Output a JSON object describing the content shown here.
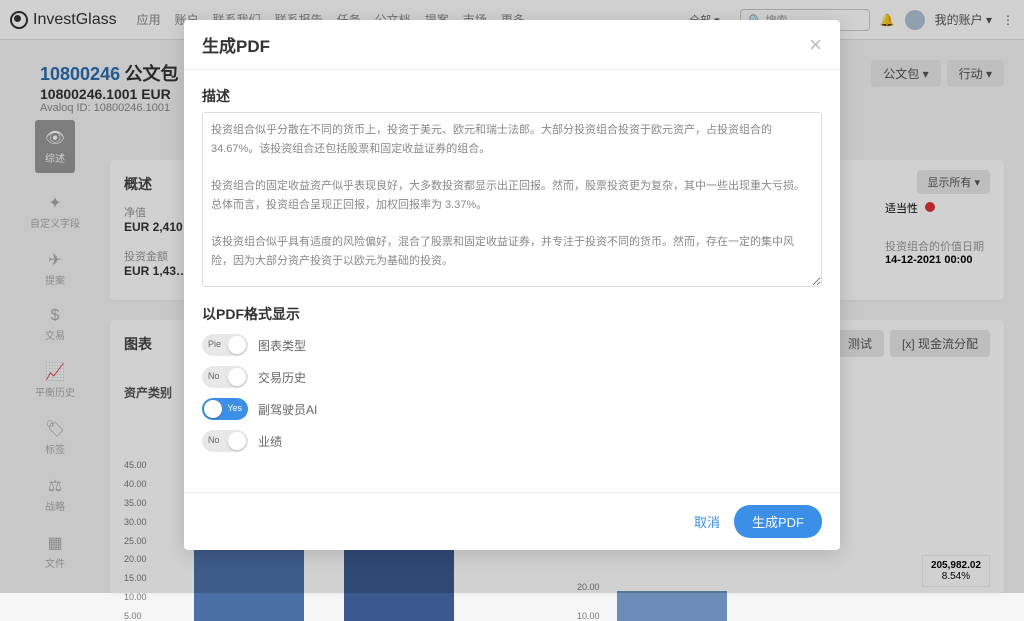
{
  "brand": "InvestGlass",
  "nav": {
    "items": [
      "应用",
      "账户",
      "联系我们",
      "联系报告",
      "任务",
      "公文档",
      "提案",
      "市场",
      "更多"
    ],
    "all": "全部",
    "search_placeholder": "搜索",
    "account": "我的账户"
  },
  "header": {
    "id1": "10800246",
    "id1_suffix": "公文包",
    "id2": "10800246.1001 EUR",
    "id3": "Avaloq ID: 10800246.1001",
    "btn_portfolio": "公文包",
    "btn_action": "行动"
  },
  "leftbar": [
    {
      "icon": "👁",
      "label": "综述"
    },
    {
      "icon": "✦",
      "label": "自定义字段"
    },
    {
      "icon": "✈",
      "label": "提案"
    },
    {
      "icon": "$",
      "label": "交易"
    },
    {
      "icon": "📈",
      "label": "平衡历史"
    },
    {
      "icon": "🏷",
      "label": "标签"
    },
    {
      "icon": "⚖",
      "label": "战略"
    },
    {
      "icon": "▦",
      "label": "文件"
    }
  ],
  "overview": {
    "title": "概述",
    "show_all": "显示所有 ▾",
    "nav_label": "净值",
    "nav_val": "EUR 2,410…",
    "inv_label": "投资金额",
    "inv_val": "EUR 1,43…",
    "suit_label": "适当性",
    "date_label": "投资组合的价值日期",
    "date_val": "14-12-2021 00:00"
  },
  "chart": {
    "title": "图表",
    "asset_class": "资产类别",
    "btns": [
      "测试",
      "[x] 现金流分配"
    ],
    "left_ticks": [
      "45.00",
      "40.00",
      "35.00",
      "30.00",
      "25.00",
      "20.00",
      "15.00",
      "10.00",
      "5.00"
    ],
    "right_ticks": [
      "20.00",
      "10.00"
    ],
    "legend_top": "205,982.02",
    "legend_bot": "8.54%"
  },
  "modal": {
    "title": "生成PDF",
    "desc_label": "描述",
    "desc_text": "投资组合似乎分散在不同的货币上，投资于美元、欧元和瑞士法郎。大部分投资组合投资于欧元资产，占投资组合的 34.67%。该投资组合还包括股票和固定收益证券的组合。\n\n投资组合的固定收益资产似乎表现良好，大多数投资都显示出正回报。然而，股票投资更为复杂，其中一些出现重大亏损。总体而言，投资组合呈现正回报，加权回报率为 3.37%。\n\n该投资组合似乎具有适度的风险偏好，混合了股票和固定收益证券，并专注于投资不同的货币。然而，存在一定的集中风险，因为大部分资产投资于以欧元为基础的投资。\n\n了解更多有关投资组合的投资目标、投资期限和风险承受能力的信息，有助于提供更详细的分析。",
    "section": "以PDF格式显示",
    "toggles": [
      {
        "on": false,
        "off_label": "Pie",
        "text": "图表类型"
      },
      {
        "on": false,
        "off_label": "No",
        "text": "交易历史"
      },
      {
        "on": true,
        "on_label": "Yes",
        "text": "副驾驶员AI"
      },
      {
        "on": false,
        "off_label": "No",
        "text": "业绩"
      }
    ],
    "cancel": "取消",
    "generate": "生成PDF"
  }
}
